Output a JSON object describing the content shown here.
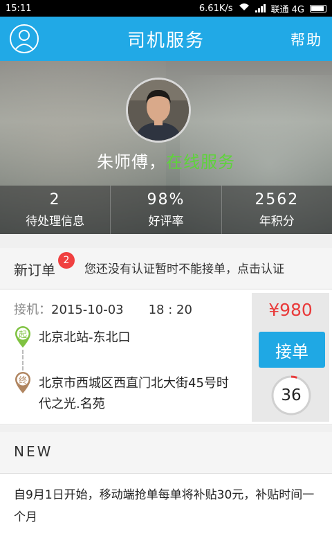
{
  "status_bar": {
    "time": "15:11",
    "net_speed": "6.61K/s",
    "carrier": "联通 4G"
  },
  "header": {
    "title": "司机服务",
    "help_label": "帮助"
  },
  "profile": {
    "name": "朱师傅，",
    "status": "在线服务",
    "status_color": "#5ed33b"
  },
  "stats": [
    {
      "value": "2",
      "label": "待处理信息"
    },
    {
      "value": "98%",
      "label": "好评率"
    },
    {
      "value": "2562",
      "label": "年积分"
    }
  ],
  "new_order": {
    "label": "新订单",
    "badge": "2",
    "notice": "您还没有认证暂时不能接单，点击认证"
  },
  "order": {
    "pickup_key": "接机：",
    "pickup_date": "2015-10-03",
    "pickup_time": "18 : 20",
    "start_marker": "起",
    "end_marker": "终",
    "start_address": "北京北站-东北口",
    "end_address": "北京市西城区西直门北大街45号时代之光.名苑",
    "price": "¥980",
    "accept_label": "接单",
    "countdown": "36",
    "countdown_progress": 0.05
  },
  "news": {
    "heading": "NEW",
    "body": "自9月1日开始，移动端抢单每单将补贴30元，补贴时间一个月"
  },
  "colors": {
    "accent": "#21a9e6",
    "price": "#e93b3b",
    "badge": "#f04040",
    "start_pin": "#7fc241",
    "end_pin": "#b08560"
  },
  "icons": {
    "avatar_button": "user-icon",
    "wifi": "wifi-icon",
    "signal": "signal-icon",
    "battery": "battery-icon"
  }
}
